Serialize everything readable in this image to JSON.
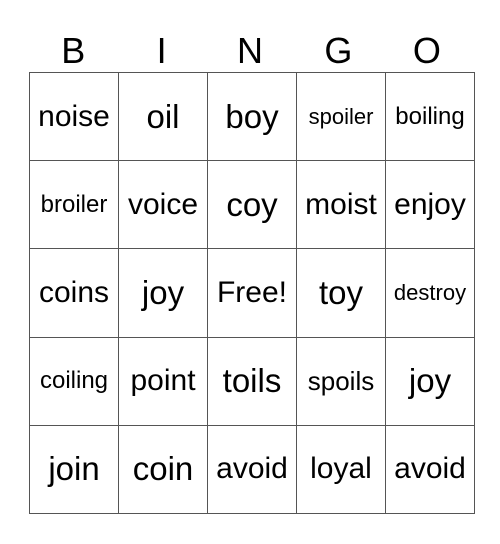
{
  "header": [
    "B",
    "I",
    "N",
    "G",
    "O"
  ],
  "cells": [
    [
      "noise",
      "oil",
      "boy",
      "spoiler",
      "boiling"
    ],
    [
      "broiler",
      "voice",
      "coy",
      "moist",
      "enjoy"
    ],
    [
      "coins",
      "joy",
      "Free!",
      "toy",
      "destroy"
    ],
    [
      "coiling",
      "point",
      "toils",
      "spoils",
      "joy"
    ],
    [
      "join",
      "coin",
      "avoid",
      "loyal",
      "avoid"
    ]
  ]
}
